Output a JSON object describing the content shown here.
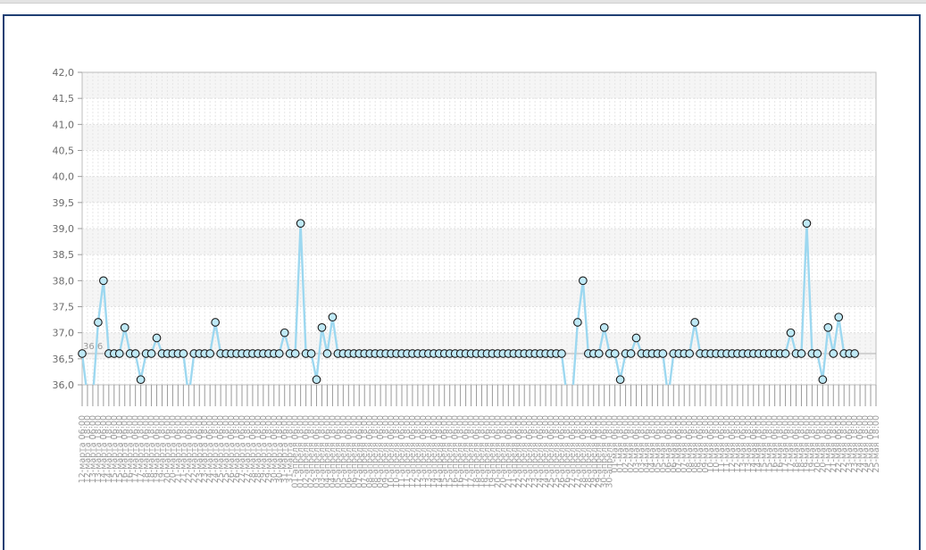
{
  "chart_data": {
    "type": "line",
    "title": "",
    "xlabel": "",
    "ylabel": "",
    "ylim": [
      36.0,
      42.0
    ],
    "y_ticks": [
      "36,0",
      "36,5",
      "37,0",
      "37,5",
      "38,0",
      "38,5",
      "39,0",
      "39,5",
      "40,0",
      "40,5",
      "41,0",
      "41,5",
      "42,0"
    ],
    "reference_line": {
      "value": 36.6,
      "label": "36,6"
    },
    "grid": true,
    "legend": "none",
    "colors": {
      "line": "#9dd8f0",
      "marker_fill": "#bfe9f6",
      "marker_stroke": "#1a1a1a",
      "reference": "#b0b0b0"
    },
    "x": [
      "12-марта 06:00",
      "12-марта 18:00",
      "13-марта 06:00",
      "13-марта 18:00",
      "14-марта 06:00",
      "14-марта 18:00",
      "15-марта 06:00",
      "15-марта 18:00",
      "16-марта 06:00",
      "16-марта 18:00",
      "17-марта 06:00",
      "17-марта 18:00",
      "18-марта 06:00",
      "18-марта 18:00",
      "19-марта 06:00",
      "19-марта 18:00",
      "20-марта 06:00",
      "20-марта 18:00",
      "21-марта 06:00",
      "21-марта 18:00",
      "22-марта 06:00",
      "22-марта 18:00",
      "23-марта 06:00",
      "23-марта 18:00",
      "24-марта 06:00",
      "24-марта 18:00",
      "25-марта 06:00",
      "25-марта 18:00",
      "26-марта 06:00",
      "26-марта 18:00",
      "27-марта 06:00",
      "27-марта 18:00",
      "28-марта 06:00",
      "28-марта 18:00",
      "29-марта 06:00",
      "29-марта 18:00",
      "30-марта 06:00",
      "30-марта 18:00",
      "31-марта 06:00",
      "31-марта 18:00",
      "01-апреля 06:00",
      "01-апреля 18:00",
      "02-апреля 06:00",
      "02-апреля 18:00",
      "03-апреля 06:00",
      "03-апреля 18:00",
      "04-апреля 06:00",
      "04-апреля 18:00",
      "05-апреля 06:00",
      "05-апреля 18:00",
      "06-апреля 06:00",
      "06-апреля 18:00",
      "07-апреля 06:00",
      "07-апреля 18:00",
      "08-апреля 06:00",
      "08-апреля 18:00",
      "09-апреля 06:00",
      "09-апреля 18:00",
      "10-апреля 06:00",
      "10-апреля 18:00",
      "11-апреля 06:00",
      "11-апреля 18:00",
      "12-апреля 06:00",
      "12-апреля 18:00",
      "13-апреля 06:00",
      "13-апреля 18:00",
      "14-апреля 06:00",
      "14-апреля 18:00",
      "15-апреля 06:00",
      "15-апреля 18:00",
      "16-апреля 06:00",
      "16-апреля 18:00",
      "17-апреля 06:00",
      "17-апреля 18:00",
      "18-апреля 06:00",
      "18-апреля 18:00",
      "19-апреля 06:00",
      "19-апреля 18:00",
      "20-апреля 06:00",
      "20-апреля 18:00",
      "21-апреля 06:00",
      "21-апреля 18:00",
      "22-апреля 06:00",
      "22-апреля 18:00",
      "23-апреля 06:00",
      "23-апреля 18:00",
      "24-апреля 06:00",
      "24-апреля 18:00",
      "25-апреля 06:00",
      "25-апреля 18:00",
      "26-апреля 06:00",
      "26-апреля 18:00",
      "27-апреля 06:00",
      "27-апреля 18:00",
      "28-апреля 06:00",
      "28-апреля 18:00",
      "29-апреля 06:00",
      "29-апреля 18:00",
      "30-апреля 06:00",
      "30-апреля 18:00",
      "01-мая 06:00",
      "01-мая 18:00",
      "02-мая 06:00",
      "02-мая 18:00",
      "03-мая 06:00",
      "03-мая 18:00",
      "04-мая 06:00",
      "04-мая 18:00",
      "05-мая 06:00",
      "05-мая 18:00",
      "06-мая 06:00",
      "06-мая 18:00",
      "07-мая 06:00",
      "07-мая 18:00",
      "08-мая 06:00",
      "08-мая 18:00",
      "09-мая 06:00",
      "09-мая 18:00",
      "10-мая 06:00",
      "10-мая 18:00",
      "11-мая 06:00",
      "11-мая 18:00",
      "12-мая 06:00",
      "12-мая 18:00",
      "13-мая 06:00",
      "13-мая 18:00",
      "14-мая 06:00",
      "14-мая 18:00",
      "15-мая 06:00",
      "15-мая 18:00",
      "16-мая 06:00",
      "16-мая 18:00",
      "17-мая 06:00",
      "17-мая 18:00",
      "18-мая 06:00",
      "18-мая 18:00",
      "19-мая 06:00",
      "19-мая 18:00",
      "20-мая 06:00",
      "20-мая 18:00",
      "21-мая 06:00",
      "21-мая 18:00",
      "22-мая 06:00",
      "22-мая 18:00",
      "23-мая 06:00",
      "23-мая 18:00",
      "24-мая 06:00",
      "24-мая 18:00",
      "25-мая 06:00",
      "25-мая 18:00"
    ],
    "series": [
      {
        "values": [
          36.6,
          null,
          null,
          37.2,
          38.0,
          36.6,
          36.6,
          36.6,
          37.1,
          36.6,
          36.6,
          36.1,
          36.6,
          36.6,
          36.9,
          36.6,
          36.6,
          36.6,
          36.6,
          36.6,
          null,
          36.6,
          36.6,
          36.6,
          36.6,
          37.2,
          36.6,
          36.6,
          36.6,
          36.6,
          36.6,
          36.6,
          36.6,
          36.6,
          36.6,
          36.6,
          36.6,
          36.6,
          37.0,
          36.6,
          36.6,
          39.1,
          36.6,
          36.6,
          36.1,
          37.1,
          36.6,
          37.3,
          36.6,
          36.6,
          36.6,
          36.6,
          36.6,
          36.6,
          36.6,
          36.6,
          36.6,
          36.6,
          36.6,
          36.6,
          36.6,
          36.6,
          36.6,
          36.6,
          36.6,
          36.6,
          36.6,
          36.6,
          36.6,
          36.6,
          36.6,
          36.6,
          36.6,
          36.6,
          36.6,
          36.6,
          36.6,
          36.6,
          36.6,
          36.6,
          36.6,
          36.6,
          36.6,
          36.6,
          36.6,
          36.6,
          36.6,
          36.6,
          36.6,
          36.6,
          36.6,
          null,
          null,
          37.2,
          38.0,
          36.6,
          36.6,
          36.6,
          37.1,
          36.6,
          36.6,
          36.1,
          36.6,
          36.6,
          36.9,
          36.6,
          36.6,
          36.6,
          36.6,
          36.6,
          null,
          36.6,
          36.6,
          36.6,
          36.6,
          37.2,
          36.6,
          36.6,
          36.6,
          36.6,
          36.6,
          36.6,
          36.6,
          36.6,
          36.6,
          36.6,
          36.6,
          36.6,
          36.6,
          36.6,
          36.6,
          36.6,
          36.6,
          37.0,
          36.6,
          36.6,
          39.1,
          36.6,
          36.6,
          36.1,
          37.1,
          36.6,
          37.3,
          36.6,
          36.6,
          36.6
        ]
      }
    ]
  }
}
